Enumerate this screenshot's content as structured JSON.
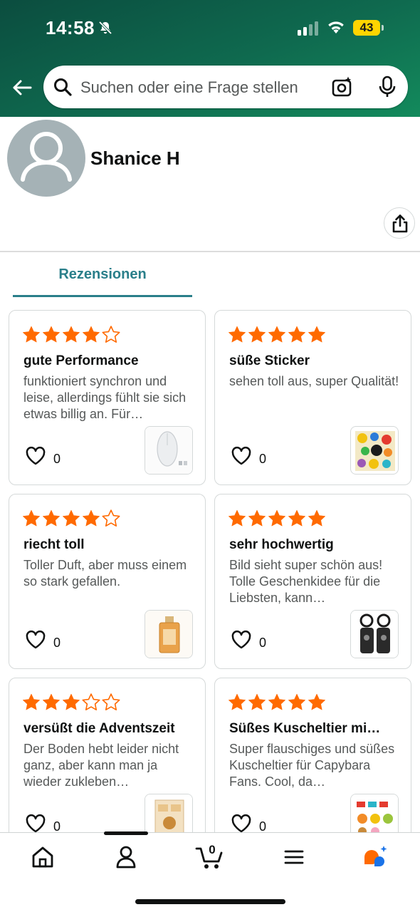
{
  "status_bar": {
    "time": "14:58",
    "battery": "43"
  },
  "search": {
    "placeholder": "Suchen oder eine Frage stellen"
  },
  "profile": {
    "name": "Shanice H"
  },
  "tabs": [
    {
      "label": "Rezensionen",
      "active": true
    }
  ],
  "colors": {
    "header_dark": "#0b4d3f",
    "header_light": "#138a5c",
    "star": "#ff6a00",
    "accent": "#2a7f8a",
    "battery": "#ffd500"
  },
  "reviews": [
    {
      "rating": 4,
      "title": "gute Performance",
      "body": "funktioniert synchron und leise, allerdings fühlt sie sich etwas billig an. Für…",
      "likes": "0",
      "product": "mouse"
    },
    {
      "rating": 5,
      "title": "süße Sticker",
      "body": "sehen toll aus, super Qualität!",
      "likes": "0",
      "product": "stickers"
    },
    {
      "rating": 4,
      "title": "riecht toll",
      "body": "Toller Duft, aber muss einem so stark gefallen.",
      "likes": "0",
      "product": "perfume"
    },
    {
      "rating": 5,
      "title": "sehr hochwertig",
      "body": "Bild sieht super schön aus! Tolle Geschenkidee für die Liebsten, kann…",
      "likes": "0",
      "product": "keychains"
    },
    {
      "rating": 3,
      "title": "versüßt die Adventszeit",
      "body": "Der Boden hebt leider nicht ganz, aber kann man ja wieder zukleben…",
      "likes": "0",
      "product": "advent-box"
    },
    {
      "rating": 5,
      "title": "Süßes Kuscheltier mi…",
      "body": "Super flauschiges und süßes Kuscheltier für Capybara Fans. Cool, da…",
      "likes": "0",
      "product": "plush-set"
    }
  ],
  "bottom_nav": {
    "cart_count": "0",
    "items": [
      "home",
      "account",
      "cart",
      "menu",
      "rufus"
    ]
  }
}
